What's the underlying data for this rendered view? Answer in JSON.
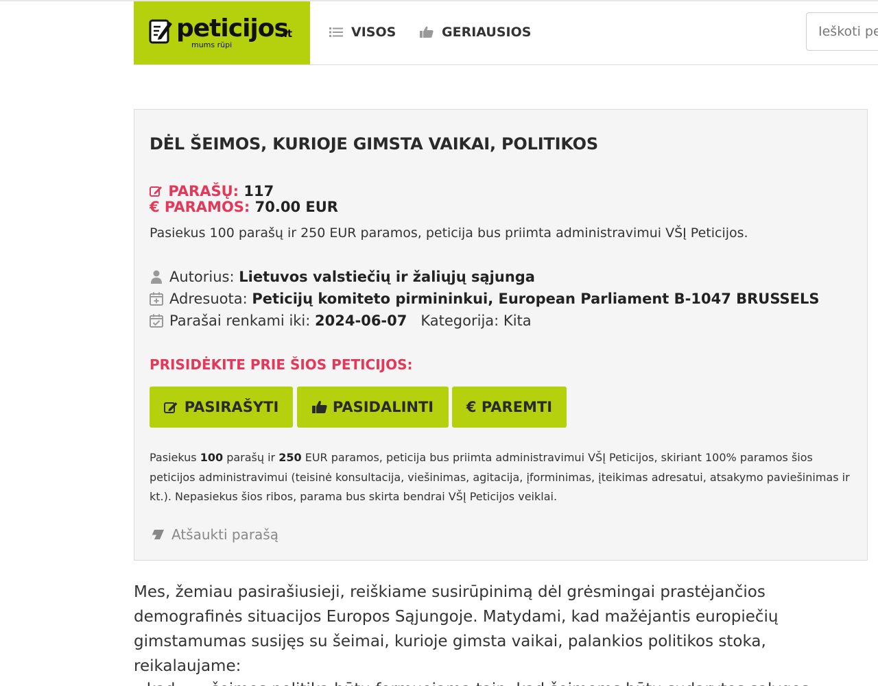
{
  "colors": {
    "brand_green": "#b5d10e",
    "accent_red": "#e2395a",
    "card_bg": "#f5f5f5"
  },
  "header": {
    "logo_word": "peticijos",
    "logo_tld": ".lt",
    "logo_slogan": "mums rūpi",
    "nav": [
      {
        "label": "VISOS",
        "icon": "list-icon"
      },
      {
        "label": "GERIAUSIOS",
        "icon": "thumbs-up-icon"
      }
    ],
    "search_placeholder": "Ieškoti peticijų"
  },
  "petition": {
    "title": "DĖL ŠEIMOS, KURIOJE GIMSTA VAIKAI, POLITIKOS",
    "signatures_label": "PARAŠŲ:",
    "signatures_value": "117",
    "support_label": "€ PARAMOS:",
    "support_value": "70.00 EUR",
    "goal_text": "Pasiekus 100 parašų ir 250 EUR paramos, peticija bus priimta administravimui VŠĮ Peticijos.",
    "author_label": "Autorius:",
    "author_value": "Lietuvos valstiečių ir žaliųjų sąjunga",
    "addressed_label": "Adresuota:",
    "addressed_value": "Peticijų komiteto pirmininkui, European Parliament B-1047 BRUSSELS",
    "deadline_label": "Parašai renkami iki:",
    "deadline_value": "2024-06-07",
    "category_label": "Kategorija:",
    "category_value": "Kita",
    "join_label": "PRISIDĖKITE PRIE ŠIOS PETICIJOS:",
    "buttons": {
      "sign": "PASIRAŠYTI",
      "share": "PASIDALINTI",
      "support": "€ PAREMTI"
    },
    "note": {
      "p1": "Pasiekus ",
      "n1": "100",
      "p2": " parašų ir ",
      "n2": "250",
      "p3": " EUR paramos, peticija bus priimta administravimui VŠĮ Peticijos, skiriant 100% paramos šios peticijos administravimui (teisinė konsultacija, viešinimas, agitacija, įforminimas, įteikimas adresatui, atsakymo paviešinimas ir kt.). Nepasiekus šios ribos, parama bus skirta bendrai VŠĮ Peticijos veiklai."
    },
    "revoke_label": "Atšaukti parašą"
  },
  "body": {
    "paragraph": "Mes, žemiau pasirašiusieji, reiškiame susirūpinimą dėl grėsmingai prastėjančios demografinės situacijos Europos Sąjungoje. Matydami, kad mažėjantis europiečių gimstamumas susijęs su šeimai, kurioje gimsta vaikai, palankios politikos stoka, reikalaujame:",
    "cut_line": "– kad ….. šeimos politika būtų formuojama taip, kad šeimoms būtų sudarytos sąlygos"
  }
}
